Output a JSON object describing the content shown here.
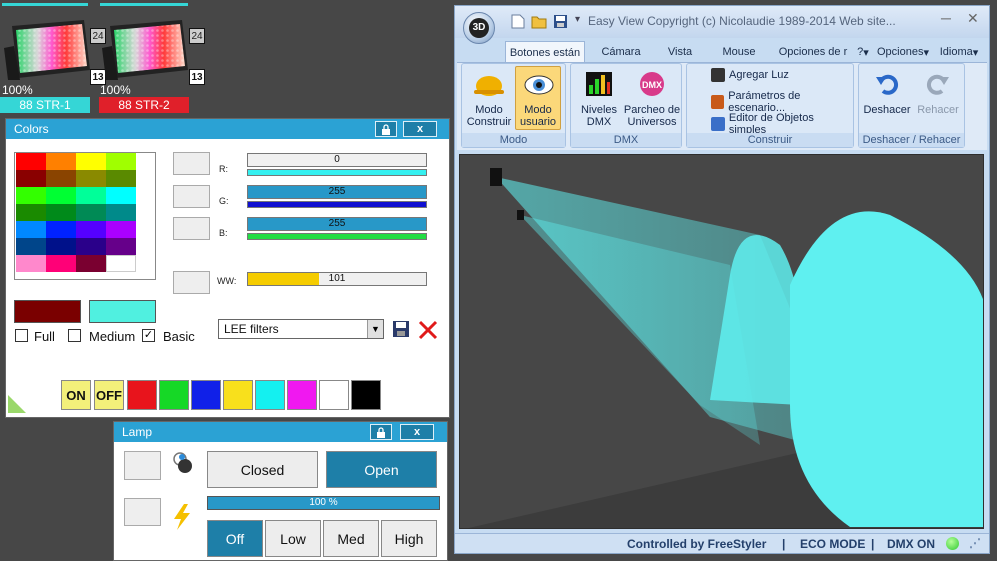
{
  "fixtures": [
    {
      "percent": "100%",
      "channel": "24",
      "address": "13",
      "name": "88 STR-1",
      "label_color": "#35d6d6"
    },
    {
      "percent": "100%",
      "channel": "24",
      "address": "13",
      "name": "88 STR-2",
      "label_color": "#e0202a"
    }
  ],
  "colors_panel": {
    "title": "Colors",
    "lock_icon": "lock-icon",
    "close_label": "x",
    "sliders": [
      {
        "label": "R:",
        "value": "0",
        "level": 0,
        "bar_color": "#35f0f0"
      },
      {
        "label": "G:",
        "value": "255",
        "level": 1,
        "bar_color": "#1010d0"
      },
      {
        "label": "B:",
        "value": "255",
        "level": 1,
        "bar_color": "#22dd44"
      },
      {
        "label": "WW:",
        "value": "101",
        "level": 0.4
      }
    ],
    "filter_select": {
      "value": "LEE filters"
    },
    "checkboxes": [
      {
        "label": "Full",
        "checked": false
      },
      {
        "label": "Medium",
        "checked": false
      },
      {
        "label": "Basic",
        "checked": true
      }
    ],
    "on_label": "ON",
    "off_label": "OFF",
    "quick_colors": [
      "#e8141c",
      "#16d826",
      "#1020e8",
      "#f8e01c",
      "#14f0f0",
      "#f018f0",
      "#ffffff",
      "#000000"
    ],
    "current_color_left": "#7a0000",
    "current_color_right": "#50f0e0"
  },
  "lamp_panel": {
    "title": "Lamp",
    "close_label": "x",
    "closed_label": "Closed",
    "open_label": "Open",
    "progress_label": "100 %",
    "progress": 1,
    "modes": [
      "Off",
      "Low",
      "Med",
      "High"
    ]
  },
  "easyview": {
    "title": "Easy View  Copyright (c) Nicolaudie 1989-2014  Web site...",
    "logo": "3D",
    "tabs": [
      "Botones están",
      "Cámara",
      "Vista",
      "Mouse",
      "Opciones de r"
    ],
    "right_menus": [
      "?",
      "Opciones",
      "Idioma"
    ],
    "groups": {
      "modo": {
        "label": "Modo",
        "buttons": [
          "Modo Construir",
          "Modo usuario"
        ]
      },
      "dmx": {
        "label": "DMX",
        "buttons": [
          "Niveles DMX",
          "Parcheo de Universos"
        ]
      },
      "construir": {
        "label": "Construir",
        "items": [
          "Agregar Luz",
          "Parámetros de escenario...",
          "Editor de Objetos simples"
        ]
      },
      "deshacer": {
        "label": "Deshacer / Rehacer",
        "buttons": [
          "Deshacer",
          "Rehacer"
        ]
      }
    },
    "status": {
      "controlled": "Controlled by FreeStyler",
      "sep": "|",
      "eco": "ECO MODE",
      "dmx": "DMX ON"
    }
  }
}
